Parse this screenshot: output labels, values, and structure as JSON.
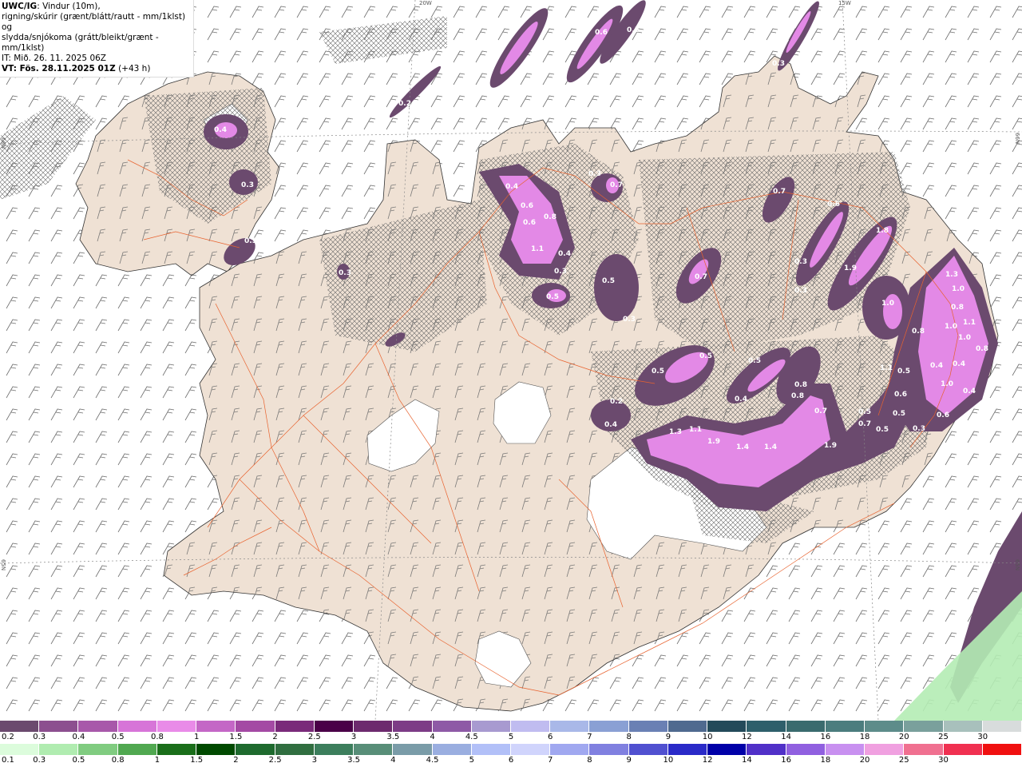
{
  "header": {
    "title_bold": "UWC/IG",
    "title_rest": ": Vindur (10m),",
    "line2": "rigning/skúrir (grænt/blátt/rautt - mm/1klst) og",
    "line3": "slydda/snjókoma (grátt/bleikt/grænt - mm/1klst)",
    "line4": "IT: Mið. 26. 11. 2025 06Z",
    "line5_bold": "VT: Fös. 28.11.2025 01Z",
    "line5_rest": " (+43 h)"
  },
  "grid_labels": {
    "lon_20w": "20W",
    "lon_15w": "15W",
    "lat_66n_left": "66N",
    "lat_66n_right": "66N",
    "lat_65n_left": "65N",
    "lat_65n_right": "65N"
  },
  "precip_labels": [
    {
      "id": "l1",
      "text": "0.4"
    },
    {
      "id": "l2",
      "text": "0.3"
    },
    {
      "id": "l3",
      "text": "0.5"
    },
    {
      "id": "l4",
      "text": "0.3"
    },
    {
      "id": "l5",
      "text": "0.2"
    },
    {
      "id": "l6",
      "text": "0.6"
    },
    {
      "id": "l7",
      "text": "0.5"
    },
    {
      "id": "l8",
      "text": "0.3"
    },
    {
      "id": "l9",
      "text": "0.4"
    },
    {
      "id": "l10",
      "text": "0.6"
    },
    {
      "id": "l11",
      "text": "0.6"
    },
    {
      "id": "l12",
      "text": "0.8"
    },
    {
      "id": "l13",
      "text": "1.1"
    },
    {
      "id": "l14",
      "text": "0.4"
    },
    {
      "id": "l15",
      "text": "0.3"
    },
    {
      "id": "l16",
      "text": "0.5"
    },
    {
      "id": "l17",
      "text": "0.3"
    },
    {
      "id": "l18",
      "text": "0.7"
    },
    {
      "id": "l19",
      "text": "0.5"
    },
    {
      "id": "l20",
      "text": "0.3"
    },
    {
      "id": "l21",
      "text": "0.7"
    },
    {
      "id": "l22",
      "text": "0.7"
    },
    {
      "id": "l23",
      "text": "0.6"
    },
    {
      "id": "l24",
      "text": "1.8"
    },
    {
      "id": "l25",
      "text": "1.9"
    },
    {
      "id": "l26",
      "text": "0.3"
    },
    {
      "id": "l27",
      "text": "0.3"
    },
    {
      "id": "l28",
      "text": "1.3"
    },
    {
      "id": "l29",
      "text": "1.0"
    },
    {
      "id": "l30",
      "text": "1.0"
    },
    {
      "id": "l31",
      "text": "0.8"
    },
    {
      "id": "l32",
      "text": "1.0"
    },
    {
      "id": "l33",
      "text": "1.1"
    },
    {
      "id": "l34",
      "text": "0.8"
    },
    {
      "id": "l35",
      "text": "1.0"
    },
    {
      "id": "l36",
      "text": "0.8"
    },
    {
      "id": "l37",
      "text": "0.5"
    },
    {
      "id": "l38",
      "text": "0.5"
    },
    {
      "id": "l39",
      "text": "0.2"
    },
    {
      "id": "l40",
      "text": "0.4"
    },
    {
      "id": "l41",
      "text": "0.8"
    },
    {
      "id": "l42",
      "text": "0.8"
    },
    {
      "id": "l43",
      "text": "0.4"
    },
    {
      "id": "l44",
      "text": "0.5"
    },
    {
      "id": "l45",
      "text": "0.7"
    },
    {
      "id": "l46",
      "text": "1.3"
    },
    {
      "id": "l47",
      "text": "1.1"
    },
    {
      "id": "l48",
      "text": "1.9"
    },
    {
      "id": "l49",
      "text": "1.4"
    },
    {
      "id": "l50",
      "text": "1.4"
    },
    {
      "id": "l51",
      "text": "1.9"
    },
    {
      "id": "l52",
      "text": "0.4"
    },
    {
      "id": "l53",
      "text": "1.1"
    },
    {
      "id": "l54",
      "text": "0.5"
    },
    {
      "id": "l55",
      "text": "0.6"
    },
    {
      "id": "l56",
      "text": "0.5"
    },
    {
      "id": "l57",
      "text": "0.5"
    },
    {
      "id": "l58",
      "text": "0.4"
    },
    {
      "id": "l59",
      "text": "0.7"
    },
    {
      "id": "l60",
      "text": "1.0"
    },
    {
      "id": "l61",
      "text": "0.4"
    },
    {
      "id": "l62",
      "text": "0.6"
    },
    {
      "id": "l63",
      "text": "0.5"
    },
    {
      "id": "l64",
      "text": "0.3"
    }
  ],
  "colorbar_snow": {
    "labels": [
      "0.2",
      "0.3",
      "0.4",
      "0.5",
      "0.8",
      "1",
      "1.5",
      "2",
      "2.5",
      "3",
      "3.5",
      "4",
      "4.5",
      "5",
      "6",
      "7",
      "8",
      "9",
      "10",
      "12",
      "14",
      "16",
      "18",
      "20",
      "25",
      "30"
    ],
    "colors": [
      "#6b4a6e",
      "#8c4f8f",
      "#a858aa",
      "#d775d8",
      "#e98be8",
      "#c467c6",
      "#a44aa4",
      "#7a2a7a",
      "#4a0048",
      "#6d2a6e",
      "#7d3c86",
      "#8e5aa6",
      "#a89ad0",
      "#c0bcf0",
      "#a9b8e8",
      "#8aa0d4",
      "#6a80b4",
      "#4f6a8f",
      "#234a5a",
      "#2e5f6b",
      "#3a6b6e",
      "#4b7d7e",
      "#5d8c8a",
      "#7aa09c",
      "#a8c0bc",
      "#d8dcdc"
    ]
  },
  "colorbar_rain": {
    "labels": [
      "0.1",
      "0.3",
      "0.5",
      "0.8",
      "1",
      "1.5",
      "2",
      "2.5",
      "3",
      "3.5",
      "4",
      "4.5",
      "5",
      "6",
      "7",
      "8",
      "9",
      "10",
      "12",
      "14",
      "16",
      "18",
      "20",
      "25",
      "30"
    ],
    "colors": [
      "#dcfcdc",
      "#b0ecb0",
      "#80cc80",
      "#50a850",
      "#1a6e1a",
      "#004a00",
      "#1e6a2e",
      "#306e40",
      "#3c7e5c",
      "#588e78",
      "#7a9ca8",
      "#9aaee0",
      "#b2c0f8",
      "#d0d4fc",
      "#a0a8f0",
      "#8080e0",
      "#5050d0",
      "#2a2ac8",
      "#0000a8",
      "#5030c8",
      "#9060e0",
      "#c890f0",
      "#f0a0e0",
      "#f07090",
      "#f03050",
      "#f01010"
    ]
  },
  "colors": {
    "land": "#efe1d4",
    "roads": "#e8622e",
    "snow_light": "#e389e6",
    "snow_dark": "#6b4a6e",
    "rain_light": "#b4ecb4"
  }
}
